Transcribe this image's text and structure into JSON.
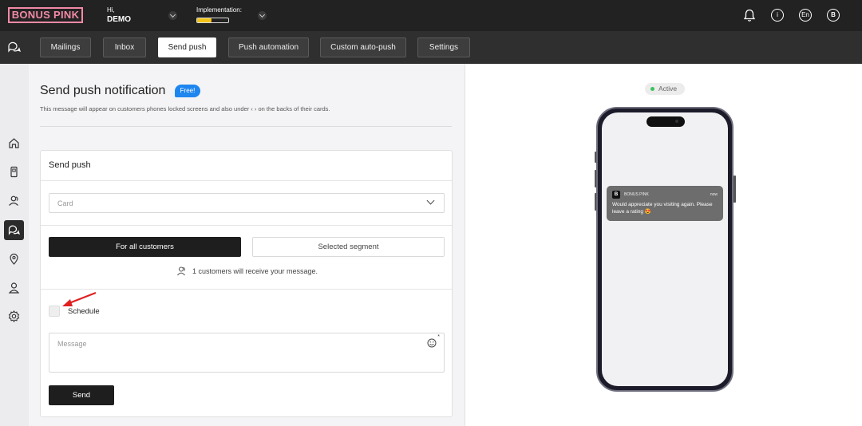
{
  "topbar": {
    "logo": "BONUS PINK",
    "greeting": "Hi,",
    "user_name": "DEMO",
    "implementation_label": "Implementation:",
    "implementation_progress": 0.45,
    "language": "En",
    "avatar_letter": "B",
    "icons": [
      "bell-icon",
      "info-icon",
      "language-icon",
      "avatar"
    ]
  },
  "nav": {
    "tabs": [
      {
        "label": "Mailings"
      },
      {
        "label": "Inbox"
      },
      {
        "label": "Send push"
      },
      {
        "label": "Push automation"
      },
      {
        "label": "Custom auto-push"
      },
      {
        "label": "Settings"
      }
    ],
    "active_tab": "Send push"
  },
  "sidebar": {
    "items": [
      "home-icon",
      "card-icon",
      "customers-icon",
      "messages-icon",
      "location-icon",
      "user-icon",
      "settings-icon"
    ],
    "active": "messages-icon"
  },
  "main": {
    "title": "Send push notification",
    "badge": "Free!",
    "subtitle": "This message will appear on customers phones locked screens and also under ‹ › on the backs of their cards.",
    "card_title": "Send push",
    "card_select_placeholder": "Card",
    "audience_all": "For all customers",
    "audience_segment": "Selected segment",
    "recipients_text": "1 customers will receive your message.",
    "schedule_label": "Schedule",
    "message_placeholder": "Message",
    "send_label": "Send"
  },
  "preview": {
    "status": "Active",
    "status_color": "#3bc25e",
    "notification": {
      "app_letter": "B",
      "app_name": "BONUS PINK",
      "time": "now",
      "message": "Would appreciate you visiting again. Please leave a rating 😍"
    }
  },
  "colors": {
    "accent": "#f28aa6",
    "badge": "#1f86ef",
    "progress": "#f2c41a",
    "annotation": "#e02020"
  }
}
